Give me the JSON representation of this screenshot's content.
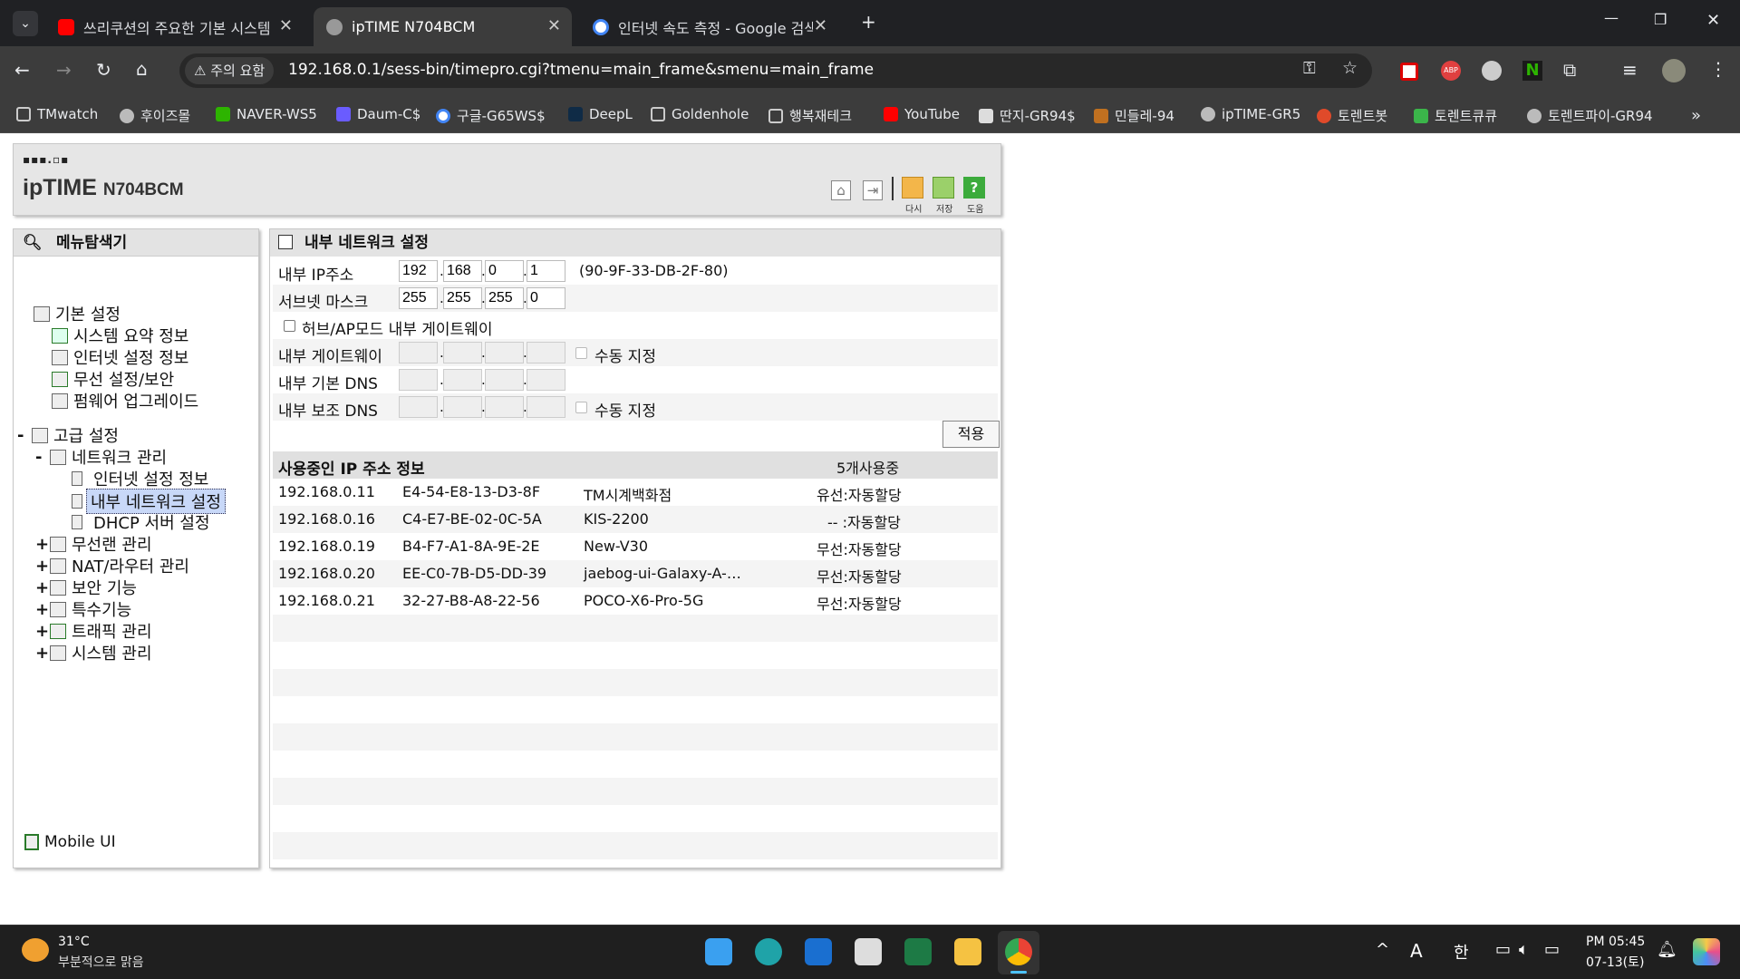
{
  "tabs": [
    {
      "title": "쓰리쿠션의 주요한 기본 시스템",
      "active": false
    },
    {
      "title": "ipTIME N704BCM",
      "active": true
    },
    {
      "title": "인터넷 속도 측정 - Google 검색",
      "active": false
    }
  ],
  "address": {
    "security_label": "주의 요함",
    "url": "192.168.0.1/sess-bin/timepro.cgi?tmenu=main_frame&smenu=main_frame"
  },
  "bookmarks": [
    "TMwatch",
    "후이즈몰",
    "NAVER-WS5",
    "Daum-C$",
    "구글-G65WS$",
    "DeepL",
    "Goldenhole",
    "행복재테크",
    "YouTube",
    "딴지-GR94$",
    "민들레-94",
    "ipTIME-GR5",
    "토렌트봇",
    "토렌트큐큐",
    "토렌트파이-GR94"
  ],
  "router": {
    "brand": "ipTIME",
    "model": "N704BCM",
    "icons": {
      "reload": "다시",
      "save": "저장",
      "help": "도움"
    }
  },
  "nav": {
    "title": "메뉴탐색기",
    "basic": {
      "label": "기본 설정",
      "items": [
        "시스템 요약 정보",
        "인터넷 설정 정보",
        "무선 설정/보안",
        "펌웨어 업그레이드"
      ]
    },
    "advanced": {
      "label": "고급 설정",
      "expander": "-"
    },
    "network": {
      "label": "네트워크 관리",
      "expander": "-",
      "items": [
        "인터넷 설정 정보",
        "내부 네트워크 설정",
        "DHCP 서버 설정"
      ]
    },
    "collapsed": [
      "무선랜 관리",
      "NAT/라우터 관리",
      "보안 기능",
      "특수기능",
      "트래픽 관리",
      "시스템 관리"
    ],
    "expander_plus": "+",
    "mobile": "Mobile UI"
  },
  "main": {
    "title": "내부 네트워크 설정",
    "ip_label": "내부 IP주소",
    "ip": [
      "192",
      "168",
      "0",
      "1"
    ],
    "mac": "(90-9F-33-DB-2F-80)",
    "mask_label": "서브넷 마스크",
    "mask": [
      "255",
      "255",
      "255",
      "0"
    ],
    "hub_label": "허브/AP모드 내부 게이트웨이",
    "gw_label": "내부 게이트웨이",
    "manual_label": "수동 지정",
    "dns1_label": "내부 기본 DNS",
    "dns2_label": "내부 보조 DNS",
    "manual_label2": "수동 지정",
    "apply": "적용",
    "list_title": "사용중인 IP 주소 정보",
    "list_count": "5개사용중",
    "clients": [
      {
        "ip": "192.168.0.11",
        "mac": "E4-54-E8-13-D3-8F",
        "name": "TM시계백화점",
        "type": "유선:자동할당"
      },
      {
        "ip": "192.168.0.16",
        "mac": "C4-E7-BE-02-0C-5A",
        "name": "KIS-2200",
        "type": "-- :자동할당"
      },
      {
        "ip": "192.168.0.19",
        "mac": "B4-F7-A1-8A-9E-2E",
        "name": "New-V30",
        "type": "무선:자동할당"
      },
      {
        "ip": "192.168.0.20",
        "mac": "EE-C0-7B-D5-DD-39",
        "name": "jaebog-ui-Galaxy-A-…",
        "type": "무선:자동할당"
      },
      {
        "ip": "192.168.0.21",
        "mac": "32-27-B8-A8-22-56",
        "name": "POCO-X6-Pro-5G",
        "type": "무선:자동할당"
      }
    ]
  },
  "taskbar": {
    "temp": "31°C",
    "weather": "부분적으로 맑음",
    "ime1": "A",
    "ime2": "한",
    "time": "PM 05:45",
    "date": "07-13(토)"
  }
}
